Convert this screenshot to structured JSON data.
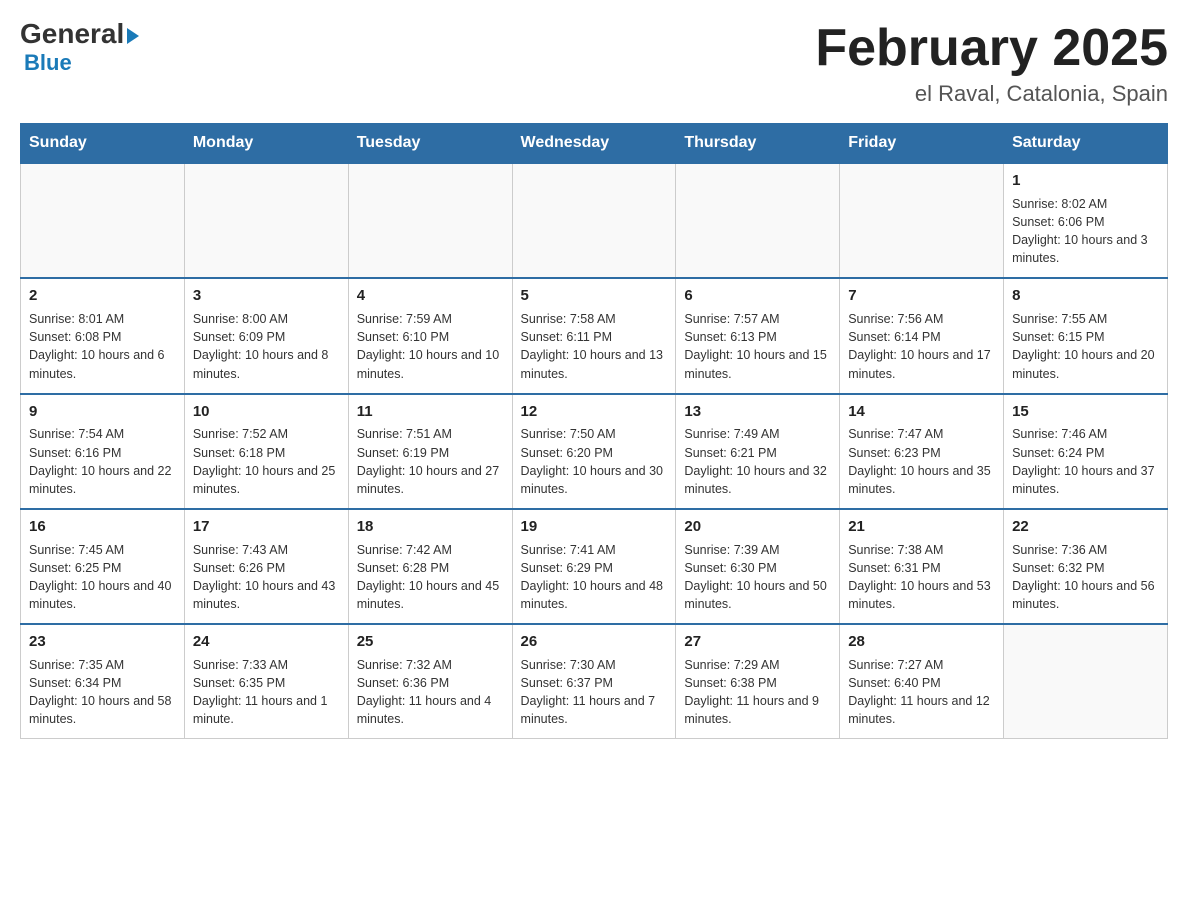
{
  "header": {
    "logo_general": "General",
    "logo_blue": "Blue",
    "month_year": "February 2025",
    "location": "el Raval, Catalonia, Spain"
  },
  "weekdays": [
    "Sunday",
    "Monday",
    "Tuesday",
    "Wednesday",
    "Thursday",
    "Friday",
    "Saturday"
  ],
  "weeks": [
    [
      {
        "day": "",
        "info": ""
      },
      {
        "day": "",
        "info": ""
      },
      {
        "day": "",
        "info": ""
      },
      {
        "day": "",
        "info": ""
      },
      {
        "day": "",
        "info": ""
      },
      {
        "day": "",
        "info": ""
      },
      {
        "day": "1",
        "info": "Sunrise: 8:02 AM\nSunset: 6:06 PM\nDaylight: 10 hours and 3 minutes."
      }
    ],
    [
      {
        "day": "2",
        "info": "Sunrise: 8:01 AM\nSunset: 6:08 PM\nDaylight: 10 hours and 6 minutes."
      },
      {
        "day": "3",
        "info": "Sunrise: 8:00 AM\nSunset: 6:09 PM\nDaylight: 10 hours and 8 minutes."
      },
      {
        "day": "4",
        "info": "Sunrise: 7:59 AM\nSunset: 6:10 PM\nDaylight: 10 hours and 10 minutes."
      },
      {
        "day": "5",
        "info": "Sunrise: 7:58 AM\nSunset: 6:11 PM\nDaylight: 10 hours and 13 minutes."
      },
      {
        "day": "6",
        "info": "Sunrise: 7:57 AM\nSunset: 6:13 PM\nDaylight: 10 hours and 15 minutes."
      },
      {
        "day": "7",
        "info": "Sunrise: 7:56 AM\nSunset: 6:14 PM\nDaylight: 10 hours and 17 minutes."
      },
      {
        "day": "8",
        "info": "Sunrise: 7:55 AM\nSunset: 6:15 PM\nDaylight: 10 hours and 20 minutes."
      }
    ],
    [
      {
        "day": "9",
        "info": "Sunrise: 7:54 AM\nSunset: 6:16 PM\nDaylight: 10 hours and 22 minutes."
      },
      {
        "day": "10",
        "info": "Sunrise: 7:52 AM\nSunset: 6:18 PM\nDaylight: 10 hours and 25 minutes."
      },
      {
        "day": "11",
        "info": "Sunrise: 7:51 AM\nSunset: 6:19 PM\nDaylight: 10 hours and 27 minutes."
      },
      {
        "day": "12",
        "info": "Sunrise: 7:50 AM\nSunset: 6:20 PM\nDaylight: 10 hours and 30 minutes."
      },
      {
        "day": "13",
        "info": "Sunrise: 7:49 AM\nSunset: 6:21 PM\nDaylight: 10 hours and 32 minutes."
      },
      {
        "day": "14",
        "info": "Sunrise: 7:47 AM\nSunset: 6:23 PM\nDaylight: 10 hours and 35 minutes."
      },
      {
        "day": "15",
        "info": "Sunrise: 7:46 AM\nSunset: 6:24 PM\nDaylight: 10 hours and 37 minutes."
      }
    ],
    [
      {
        "day": "16",
        "info": "Sunrise: 7:45 AM\nSunset: 6:25 PM\nDaylight: 10 hours and 40 minutes."
      },
      {
        "day": "17",
        "info": "Sunrise: 7:43 AM\nSunset: 6:26 PM\nDaylight: 10 hours and 43 minutes."
      },
      {
        "day": "18",
        "info": "Sunrise: 7:42 AM\nSunset: 6:28 PM\nDaylight: 10 hours and 45 minutes."
      },
      {
        "day": "19",
        "info": "Sunrise: 7:41 AM\nSunset: 6:29 PM\nDaylight: 10 hours and 48 minutes."
      },
      {
        "day": "20",
        "info": "Sunrise: 7:39 AM\nSunset: 6:30 PM\nDaylight: 10 hours and 50 minutes."
      },
      {
        "day": "21",
        "info": "Sunrise: 7:38 AM\nSunset: 6:31 PM\nDaylight: 10 hours and 53 minutes."
      },
      {
        "day": "22",
        "info": "Sunrise: 7:36 AM\nSunset: 6:32 PM\nDaylight: 10 hours and 56 minutes."
      }
    ],
    [
      {
        "day": "23",
        "info": "Sunrise: 7:35 AM\nSunset: 6:34 PM\nDaylight: 10 hours and 58 minutes."
      },
      {
        "day": "24",
        "info": "Sunrise: 7:33 AM\nSunset: 6:35 PM\nDaylight: 11 hours and 1 minute."
      },
      {
        "day": "25",
        "info": "Sunrise: 7:32 AM\nSunset: 6:36 PM\nDaylight: 11 hours and 4 minutes."
      },
      {
        "day": "26",
        "info": "Sunrise: 7:30 AM\nSunset: 6:37 PM\nDaylight: 11 hours and 7 minutes."
      },
      {
        "day": "27",
        "info": "Sunrise: 7:29 AM\nSunset: 6:38 PM\nDaylight: 11 hours and 9 minutes."
      },
      {
        "day": "28",
        "info": "Sunrise: 7:27 AM\nSunset: 6:40 PM\nDaylight: 11 hours and 12 minutes."
      },
      {
        "day": "",
        "info": ""
      }
    ]
  ]
}
